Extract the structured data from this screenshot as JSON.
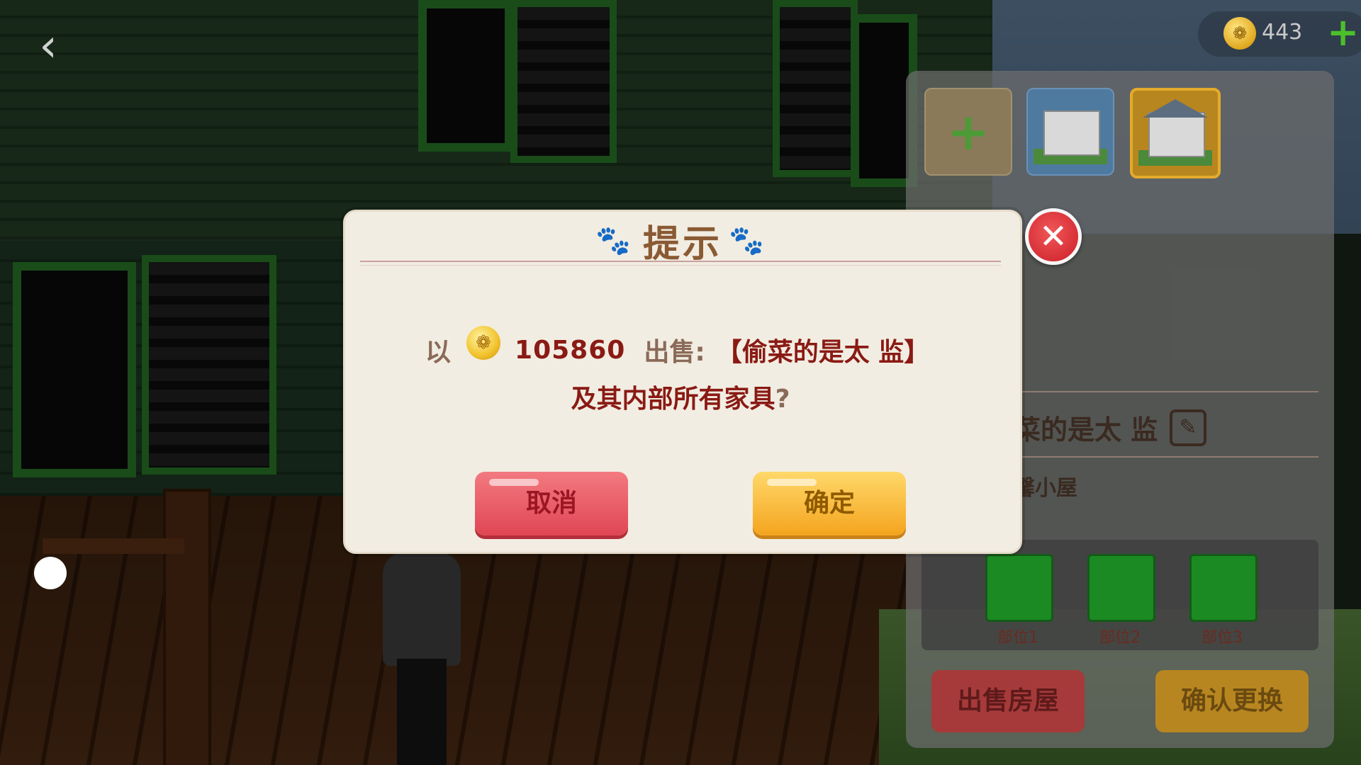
{
  "hud": {
    "back_icon": "‹",
    "coin_icon": "❁",
    "coin_count": "443",
    "add_coins_icon": "+"
  },
  "side_panel": {
    "add_slot_icon": "+",
    "house_name": "菜的是太 监",
    "edit_icon": "✎",
    "house_type": "馨小屋",
    "parts": [
      "部位1",
      "部位2",
      "部位3"
    ],
    "sell_house_label": "出售房屋",
    "confirm_change_label": "确认更换"
  },
  "dialog": {
    "title": "提示",
    "paw_icon": "🐾",
    "prefix": "以",
    "coin_icon": "❁",
    "price": "105860",
    "sell_label": "出售:",
    "house_name": "【偷菜的是太 监】",
    "line2": "及其内部所有家具",
    "question_mark": "?",
    "cancel_label": "取消",
    "confirm_label": "确定",
    "close_icon": "✕"
  }
}
